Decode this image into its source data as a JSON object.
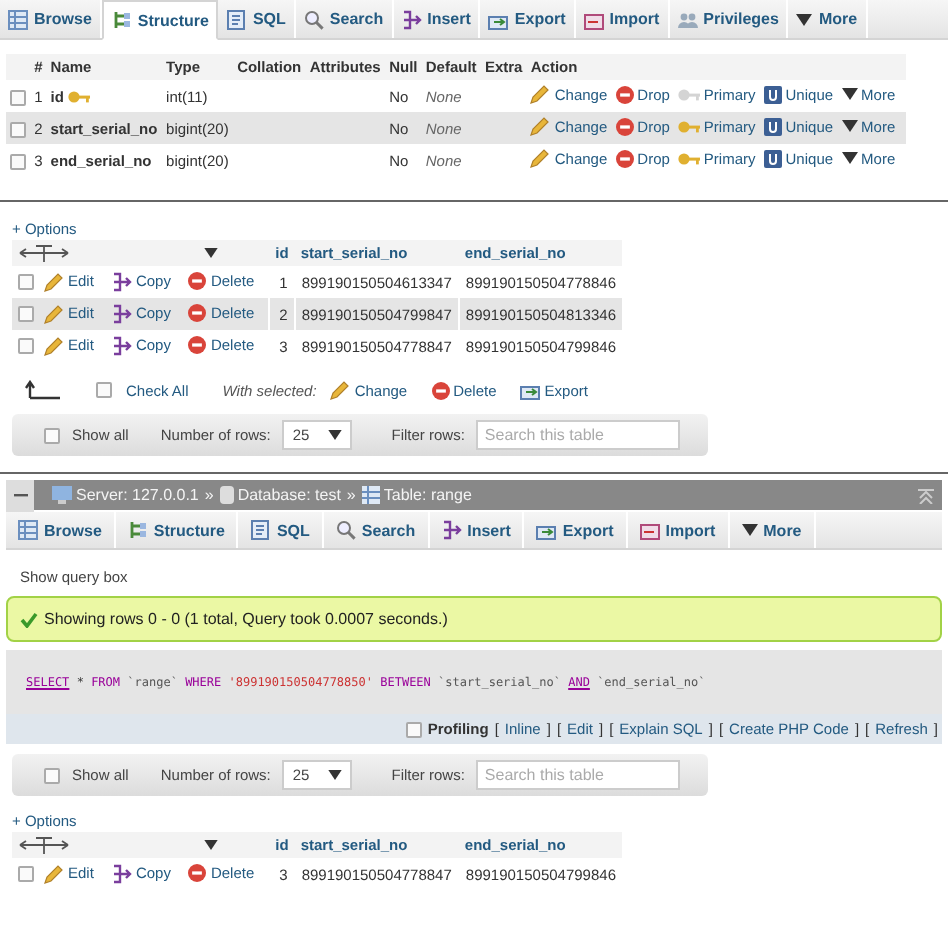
{
  "top_tabs": [
    {
      "label": "Browse",
      "kind": "browse",
      "selected": false
    },
    {
      "label": "Structure",
      "kind": "structure",
      "selected": true
    },
    {
      "label": "SQL",
      "kind": "sql",
      "selected": false
    },
    {
      "label": "Search",
      "kind": "search",
      "selected": false
    },
    {
      "label": "Insert",
      "kind": "insert",
      "selected": false
    },
    {
      "label": "Export",
      "kind": "export",
      "selected": false
    },
    {
      "label": "Import",
      "kind": "import",
      "selected": false
    },
    {
      "label": "Privileges",
      "kind": "privileges",
      "selected": false
    },
    {
      "label": "More",
      "kind": "more",
      "selected": false
    }
  ],
  "structure_table": {
    "columns": [
      "#",
      "Name",
      "Type",
      "Collation",
      "Attributes",
      "Null",
      "Default",
      "Extra",
      "Action"
    ],
    "rows": [
      {
        "checked": false,
        "number": "1",
        "name": "id",
        "primary_key": true,
        "type": "int(11)",
        "null": "No",
        "default": "None",
        "actions": [
          {
            "kind": "change",
            "label": "Change",
            "disabled": false
          },
          {
            "kind": "drop",
            "label": "Drop",
            "disabled": false
          },
          {
            "kind": "primary",
            "label": "Primary",
            "disabled": true
          },
          {
            "kind": "unique",
            "label": "Unique",
            "disabled": false
          },
          {
            "kind": "more",
            "label": "More",
            "disabled": false
          }
        ]
      },
      {
        "checked": false,
        "number": "2",
        "name": "start_serial_no",
        "primary_key": false,
        "type": "bigint(20)",
        "null": "No",
        "default": "None",
        "actions": [
          {
            "kind": "change",
            "label": "Change",
            "disabled": false
          },
          {
            "kind": "drop",
            "label": "Drop",
            "disabled": false
          },
          {
            "kind": "primary",
            "label": "Primary",
            "disabled": false
          },
          {
            "kind": "unique",
            "label": "Unique",
            "disabled": false
          },
          {
            "kind": "more",
            "label": "More",
            "disabled": false
          }
        ]
      },
      {
        "checked": false,
        "number": "3",
        "name": "end_serial_no",
        "primary_key": false,
        "type": "bigint(20)",
        "null": "No",
        "default": "None",
        "actions": [
          {
            "kind": "change",
            "label": "Change",
            "disabled": false
          },
          {
            "kind": "drop",
            "label": "Drop",
            "disabled": false
          },
          {
            "kind": "primary",
            "label": "Primary",
            "disabled": false
          },
          {
            "kind": "unique",
            "label": "Unique",
            "disabled": false
          },
          {
            "kind": "more",
            "label": "More",
            "disabled": false
          }
        ]
      }
    ]
  },
  "first_result": {
    "options": "+ Options",
    "columns": [
      "id",
      "start_serial_no",
      "end_serial_no"
    ],
    "rows": [
      {
        "checked": false,
        "id": "1",
        "start_serial_no": "899190150504613347",
        "end_serial_no": "899190150504778846",
        "actions": [
          {
            "kind": "edit",
            "label": "Edit"
          },
          {
            "kind": "copy",
            "label": "Copy"
          },
          {
            "kind": "delete",
            "label": "Delete"
          }
        ]
      },
      {
        "checked": false,
        "id": "2",
        "start_serial_no": "899190150504799847",
        "end_serial_no": "899190150504813346",
        "actions": [
          {
            "kind": "edit",
            "label": "Edit"
          },
          {
            "kind": "copy",
            "label": "Copy"
          },
          {
            "kind": "delete",
            "label": "Delete"
          }
        ]
      },
      {
        "checked": false,
        "id": "3",
        "start_serial_no": "899190150504778847",
        "end_serial_no": "899190150504799846",
        "actions": [
          {
            "kind": "edit",
            "label": "Edit"
          },
          {
            "kind": "copy",
            "label": "Copy"
          },
          {
            "kind": "delete",
            "label": "Delete"
          }
        ]
      }
    ],
    "bulk": {
      "check_all": "Check All",
      "checked": false,
      "with_selected": "With selected:",
      "actions": [
        {
          "kind": "change",
          "label": "Change"
        },
        {
          "kind": "delete",
          "label": "Delete"
        },
        {
          "kind": "export",
          "label": "Export"
        }
      ]
    }
  },
  "first_filter": {
    "show_all": "Show all",
    "show_all_checked": false,
    "rows_label": "Number of rows:",
    "rows_value": "25",
    "filter_label": "Filter rows:",
    "placeholder": "Search this table"
  },
  "breadcrumb": [
    {
      "kind": "server",
      "label": "Server: 127.0.0.1"
    },
    {
      "kind": "database",
      "separator": "»",
      "label": "Database: test"
    },
    {
      "kind": "table",
      "separator": "»",
      "label": "Table: range"
    }
  ],
  "second_tabs": [
    {
      "label": "Browse",
      "kind": "browse",
      "selected": false
    },
    {
      "label": "Structure",
      "kind": "structure",
      "selected": false
    },
    {
      "label": "SQL",
      "kind": "sql",
      "selected": false
    },
    {
      "label": "Search",
      "kind": "search",
      "selected": false
    },
    {
      "label": "Insert",
      "kind": "insert",
      "selected": false
    },
    {
      "label": "Export",
      "kind": "export",
      "selected": false
    },
    {
      "label": "Import",
      "kind": "import",
      "selected": false
    },
    {
      "label": "More",
      "kind": "more",
      "selected": false
    }
  ],
  "query": {
    "show_query_box": "Show query box",
    "message": "Showing rows 0 - 0 (1 total, Query took 0.0007 seconds.)",
    "sql": [
      {
        "kind": "linked_keyword",
        "text": "SELECT"
      },
      {
        "kind": "plain",
        "text": "*"
      },
      {
        "kind": "keyword",
        "text": "FROM"
      },
      {
        "kind": "identifier",
        "text": "`range`"
      },
      {
        "kind": "keyword",
        "text": "WHERE"
      },
      {
        "kind": "string",
        "text": "'899190150504778850'"
      },
      {
        "kind": "keyword",
        "text": "BETWEEN"
      },
      {
        "kind": "identifier",
        "text": "`start_serial_no`"
      },
      {
        "kind": "linked_keyword",
        "text": "AND"
      },
      {
        "kind": "identifier",
        "text": "`end_serial_no`"
      }
    ],
    "profiling": {
      "label": "Profiling",
      "checked": false,
      "links": [
        {
          "open": "[",
          "label": "Inline",
          "close": "]"
        },
        {
          "open": "[",
          "label": "Edit",
          "close": "]"
        },
        {
          "open": "[",
          "label": "Explain SQL",
          "close": "]"
        },
        {
          "open": "[",
          "label": "Create PHP Code",
          "close": "]"
        },
        {
          "open": "[",
          "label": "Refresh",
          "close": "]"
        }
      ]
    }
  },
  "second_filter": {
    "show_all": "Show all",
    "show_all_checked": false,
    "rows_label": "Number of rows:",
    "rows_value": "25",
    "filter_label": "Filter rows:",
    "placeholder": "Search this table"
  },
  "second_result": {
    "options": "+ Options",
    "columns": [
      "id",
      "start_serial_no",
      "end_serial_no"
    ],
    "rows": [
      {
        "checked": false,
        "id": "3",
        "start_serial_no": "899190150504778847",
        "end_serial_no": "899190150504799846",
        "actions": [
          {
            "kind": "edit",
            "label": "Edit"
          },
          {
            "kind": "copy",
            "label": "Copy"
          },
          {
            "kind": "delete",
            "label": "Delete"
          }
        ]
      }
    ]
  }
}
